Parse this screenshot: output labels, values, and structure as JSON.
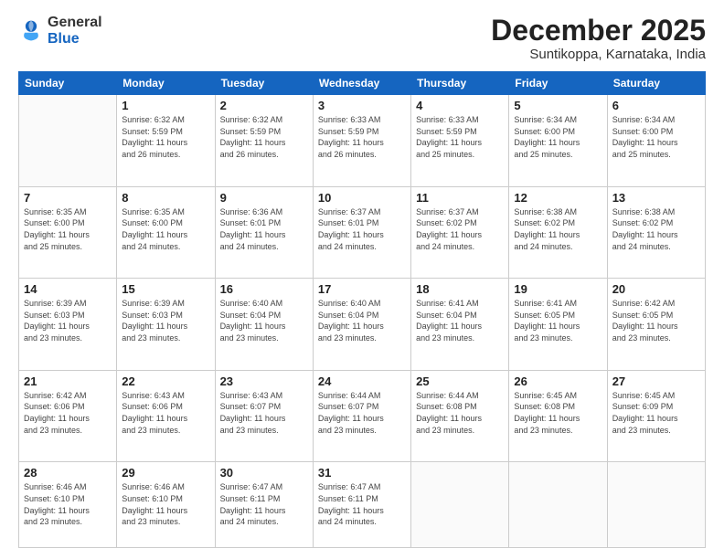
{
  "header": {
    "logo_general": "General",
    "logo_blue": "Blue",
    "month_year": "December 2025",
    "location": "Suntikoppa, Karnataka, India"
  },
  "weekdays": [
    "Sunday",
    "Monday",
    "Tuesday",
    "Wednesday",
    "Thursday",
    "Friday",
    "Saturday"
  ],
  "weeks": [
    [
      {
        "day": "",
        "info": ""
      },
      {
        "day": "1",
        "info": "Sunrise: 6:32 AM\nSunset: 5:59 PM\nDaylight: 11 hours\nand 26 minutes."
      },
      {
        "day": "2",
        "info": "Sunrise: 6:32 AM\nSunset: 5:59 PM\nDaylight: 11 hours\nand 26 minutes."
      },
      {
        "day": "3",
        "info": "Sunrise: 6:33 AM\nSunset: 5:59 PM\nDaylight: 11 hours\nand 26 minutes."
      },
      {
        "day": "4",
        "info": "Sunrise: 6:33 AM\nSunset: 5:59 PM\nDaylight: 11 hours\nand 25 minutes."
      },
      {
        "day": "5",
        "info": "Sunrise: 6:34 AM\nSunset: 6:00 PM\nDaylight: 11 hours\nand 25 minutes."
      },
      {
        "day": "6",
        "info": "Sunrise: 6:34 AM\nSunset: 6:00 PM\nDaylight: 11 hours\nand 25 minutes."
      }
    ],
    [
      {
        "day": "7",
        "info": "Sunrise: 6:35 AM\nSunset: 6:00 PM\nDaylight: 11 hours\nand 25 minutes."
      },
      {
        "day": "8",
        "info": "Sunrise: 6:35 AM\nSunset: 6:00 PM\nDaylight: 11 hours\nand 24 minutes."
      },
      {
        "day": "9",
        "info": "Sunrise: 6:36 AM\nSunset: 6:01 PM\nDaylight: 11 hours\nand 24 minutes."
      },
      {
        "day": "10",
        "info": "Sunrise: 6:37 AM\nSunset: 6:01 PM\nDaylight: 11 hours\nand 24 minutes."
      },
      {
        "day": "11",
        "info": "Sunrise: 6:37 AM\nSunset: 6:02 PM\nDaylight: 11 hours\nand 24 minutes."
      },
      {
        "day": "12",
        "info": "Sunrise: 6:38 AM\nSunset: 6:02 PM\nDaylight: 11 hours\nand 24 minutes."
      },
      {
        "day": "13",
        "info": "Sunrise: 6:38 AM\nSunset: 6:02 PM\nDaylight: 11 hours\nand 24 minutes."
      }
    ],
    [
      {
        "day": "14",
        "info": "Sunrise: 6:39 AM\nSunset: 6:03 PM\nDaylight: 11 hours\nand 23 minutes."
      },
      {
        "day": "15",
        "info": "Sunrise: 6:39 AM\nSunset: 6:03 PM\nDaylight: 11 hours\nand 23 minutes."
      },
      {
        "day": "16",
        "info": "Sunrise: 6:40 AM\nSunset: 6:04 PM\nDaylight: 11 hours\nand 23 minutes."
      },
      {
        "day": "17",
        "info": "Sunrise: 6:40 AM\nSunset: 6:04 PM\nDaylight: 11 hours\nand 23 minutes."
      },
      {
        "day": "18",
        "info": "Sunrise: 6:41 AM\nSunset: 6:04 PM\nDaylight: 11 hours\nand 23 minutes."
      },
      {
        "day": "19",
        "info": "Sunrise: 6:41 AM\nSunset: 6:05 PM\nDaylight: 11 hours\nand 23 minutes."
      },
      {
        "day": "20",
        "info": "Sunrise: 6:42 AM\nSunset: 6:05 PM\nDaylight: 11 hours\nand 23 minutes."
      }
    ],
    [
      {
        "day": "21",
        "info": "Sunrise: 6:42 AM\nSunset: 6:06 PM\nDaylight: 11 hours\nand 23 minutes."
      },
      {
        "day": "22",
        "info": "Sunrise: 6:43 AM\nSunset: 6:06 PM\nDaylight: 11 hours\nand 23 minutes."
      },
      {
        "day": "23",
        "info": "Sunrise: 6:43 AM\nSunset: 6:07 PM\nDaylight: 11 hours\nand 23 minutes."
      },
      {
        "day": "24",
        "info": "Sunrise: 6:44 AM\nSunset: 6:07 PM\nDaylight: 11 hours\nand 23 minutes."
      },
      {
        "day": "25",
        "info": "Sunrise: 6:44 AM\nSunset: 6:08 PM\nDaylight: 11 hours\nand 23 minutes."
      },
      {
        "day": "26",
        "info": "Sunrise: 6:45 AM\nSunset: 6:08 PM\nDaylight: 11 hours\nand 23 minutes."
      },
      {
        "day": "27",
        "info": "Sunrise: 6:45 AM\nSunset: 6:09 PM\nDaylight: 11 hours\nand 23 minutes."
      }
    ],
    [
      {
        "day": "28",
        "info": "Sunrise: 6:46 AM\nSunset: 6:10 PM\nDaylight: 11 hours\nand 23 minutes."
      },
      {
        "day": "29",
        "info": "Sunrise: 6:46 AM\nSunset: 6:10 PM\nDaylight: 11 hours\nand 23 minutes."
      },
      {
        "day": "30",
        "info": "Sunrise: 6:47 AM\nSunset: 6:11 PM\nDaylight: 11 hours\nand 24 minutes."
      },
      {
        "day": "31",
        "info": "Sunrise: 6:47 AM\nSunset: 6:11 PM\nDaylight: 11 hours\nand 24 minutes."
      },
      {
        "day": "",
        "info": ""
      },
      {
        "day": "",
        "info": ""
      },
      {
        "day": "",
        "info": ""
      }
    ]
  ]
}
